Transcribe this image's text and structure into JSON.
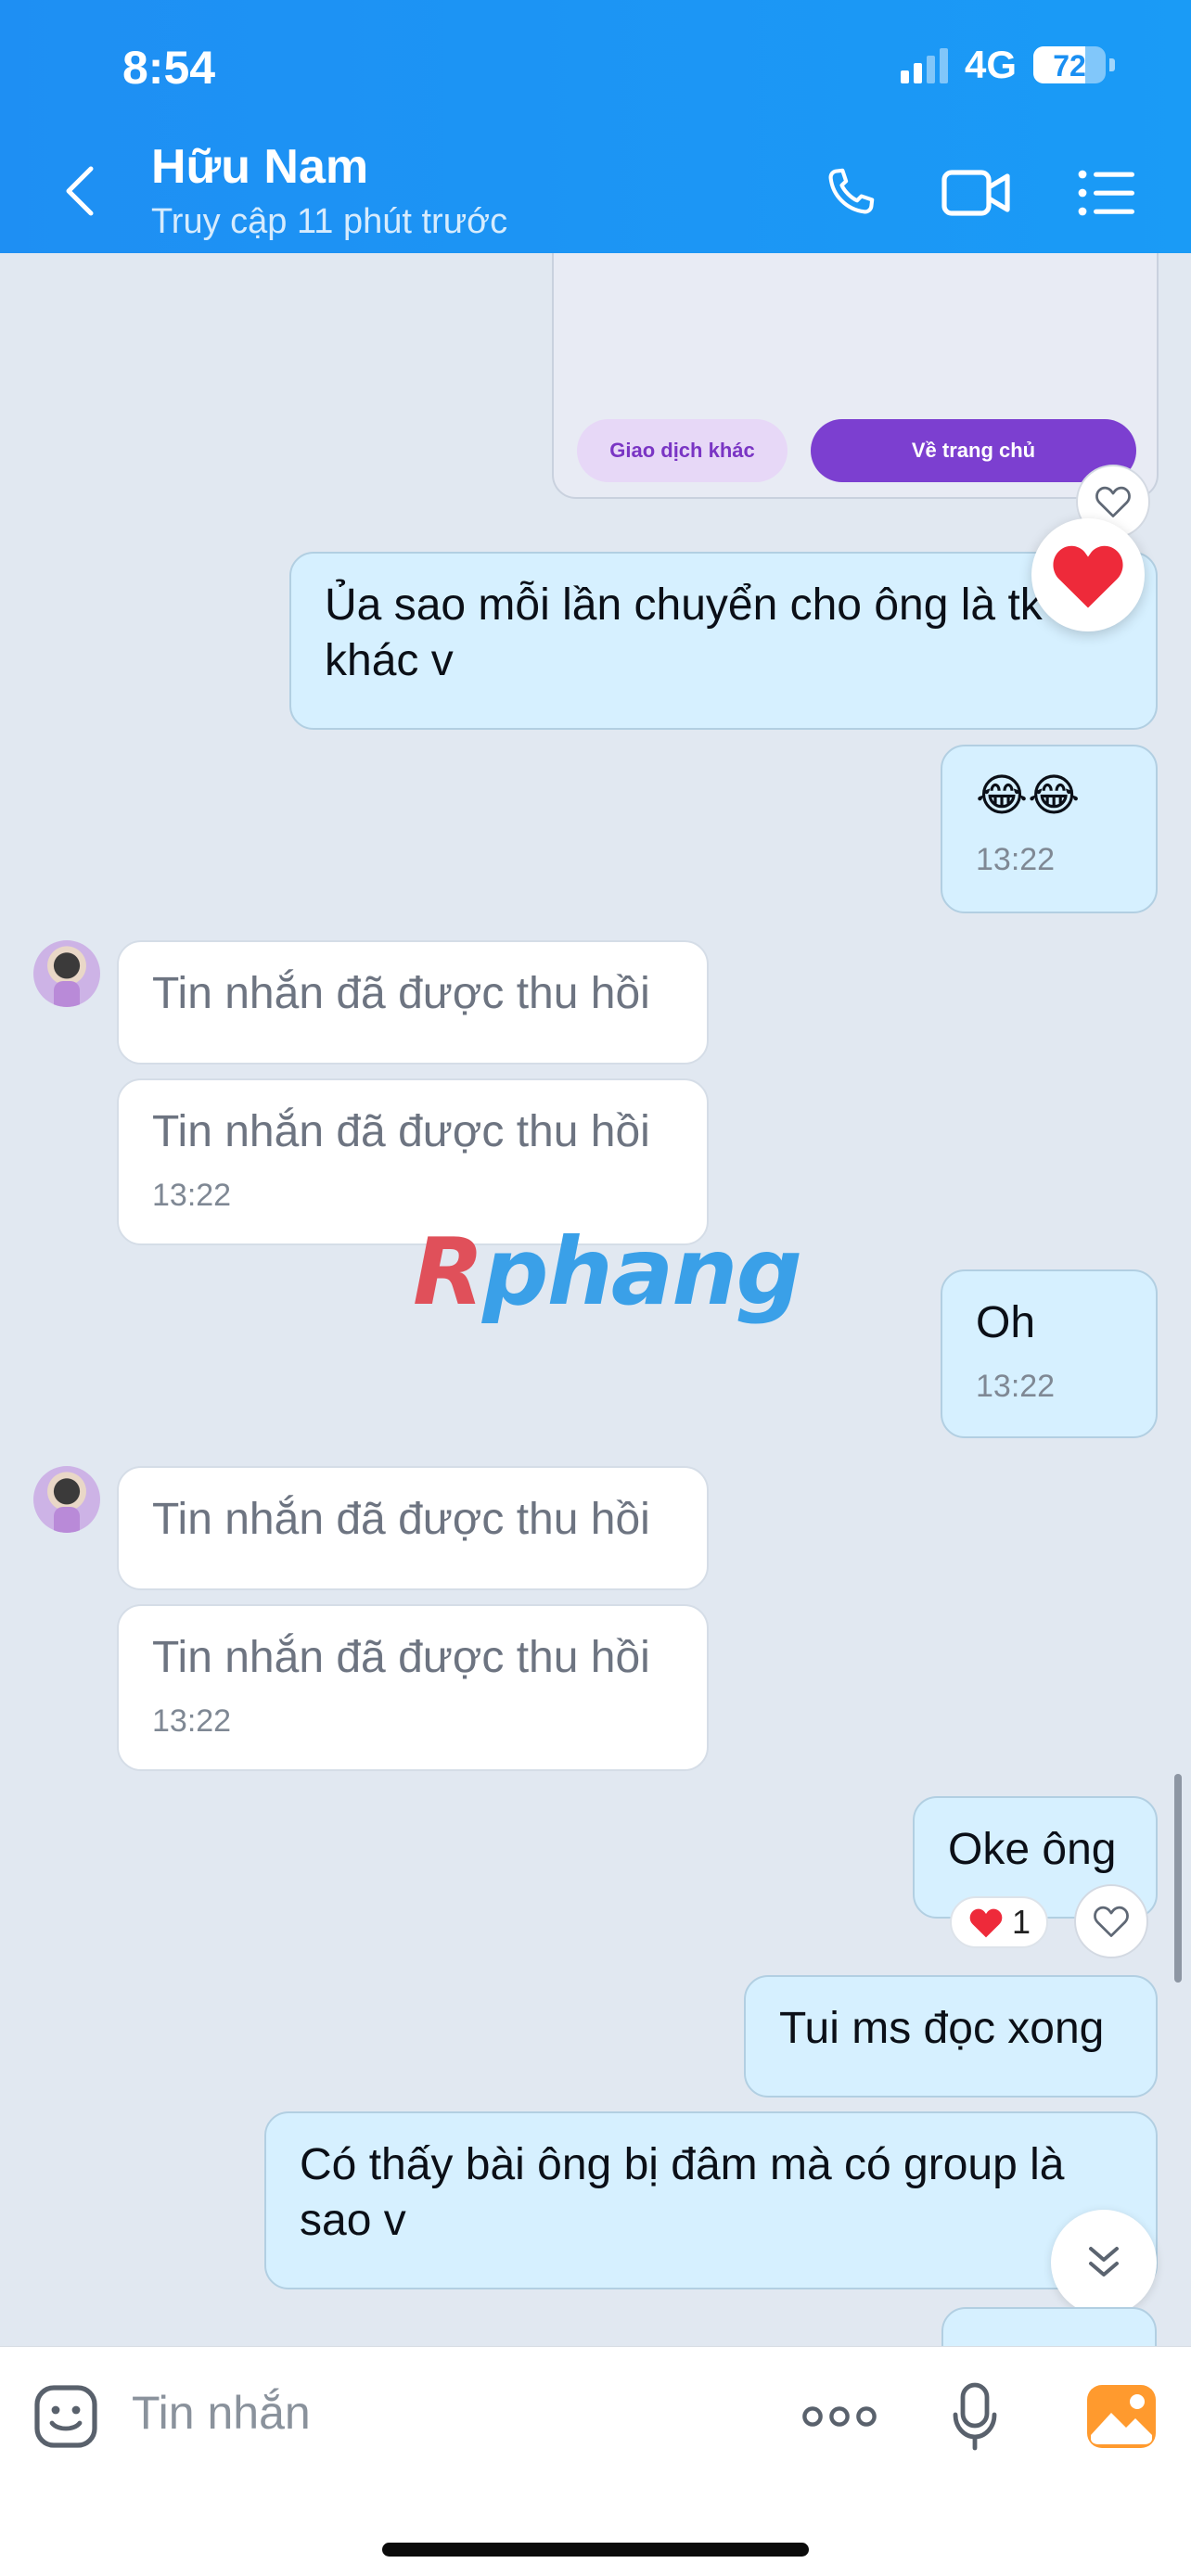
{
  "status_bar": {
    "time": "8:54",
    "network": "4G",
    "battery": "72",
    "battery_level": 0.72
  },
  "header": {
    "contact_name": "Hữu Nam",
    "last_seen": "Truy cập 11 phút trước",
    "icons": [
      "back-arrow-icon",
      "phone-icon",
      "video-call-icon",
      "menu-list-icon"
    ],
    "accent_color": "#1a8ff2"
  },
  "card": {
    "secondary_button": "Giao dịch khác",
    "primary_button": "Về trang chủ"
  },
  "messages": [
    {
      "direction": "out",
      "text": "Ủa sao mỗi lần chuyển cho ông là tk khác v",
      "reaction": "heart"
    },
    {
      "direction": "out",
      "text": "😂😂",
      "time": "13:22"
    },
    {
      "direction": "in",
      "text": "Tin nhắn đã được thu hồi"
    },
    {
      "direction": "in",
      "text": "Tin nhắn đã được thu hồi",
      "time": "13:22"
    },
    {
      "direction": "out",
      "text": "Oh",
      "time": "13:22"
    },
    {
      "direction": "in",
      "text": "Tin nhắn đã được thu hồi"
    },
    {
      "direction": "in",
      "text": "Tin nhắn đã được thu hồi",
      "time": "13:22"
    },
    {
      "direction": "out",
      "text": "Oke ông",
      "reaction_count": "1"
    },
    {
      "direction": "out",
      "text": "Tui ms đọc xong"
    },
    {
      "direction": "out",
      "text": "Có thấy bài ông bị đâm mà có group là sao v"
    }
  ],
  "watermark": {
    "first": "R",
    "rest": "phang"
  },
  "input_bar": {
    "placeholder": "Tin nhắn"
  }
}
